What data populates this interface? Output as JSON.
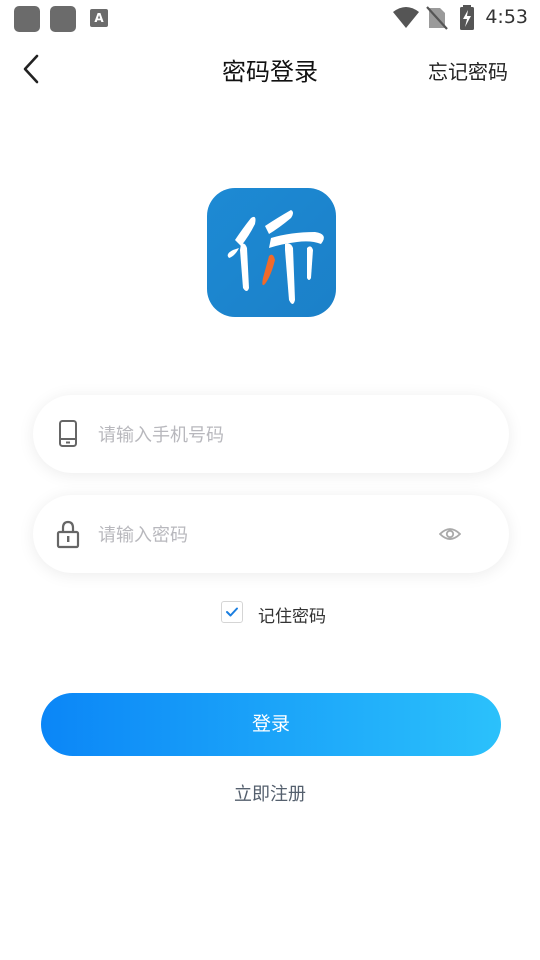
{
  "status_bar": {
    "time": "4:53",
    "notification_icons": [
      "app-notification-icon",
      "app-notification-icon",
      "a-notification-icon"
    ],
    "a_glyph": "A",
    "right_icons": [
      "wifi-icon",
      "no-sim-icon",
      "battery-charging-icon"
    ]
  },
  "nav": {
    "title": "密码登录",
    "forgot_label": "忘记密码",
    "back_icon": "chevron-left-icon"
  },
  "logo": {
    "icon": "app-logo",
    "colors": {
      "bg": "#1d8ad4",
      "brush": "#ffffff",
      "accent": "#f06a2a"
    }
  },
  "form": {
    "phone": {
      "placeholder": "请输入手机号码",
      "icon": "phone-icon",
      "value": ""
    },
    "password": {
      "placeholder": "请输入密码",
      "icon": "lock-icon",
      "toggle_icon": "eye-icon",
      "value": ""
    },
    "remember": {
      "label": "记住密码",
      "checked": true
    }
  },
  "actions": {
    "login_label": "登录",
    "register_label": "立即注册"
  },
  "colors": {
    "primary_start": "#0b86f7",
    "primary_end": "#2bc1fb",
    "check": "#1a7ee0",
    "placeholder": "#b8b8bd"
  }
}
